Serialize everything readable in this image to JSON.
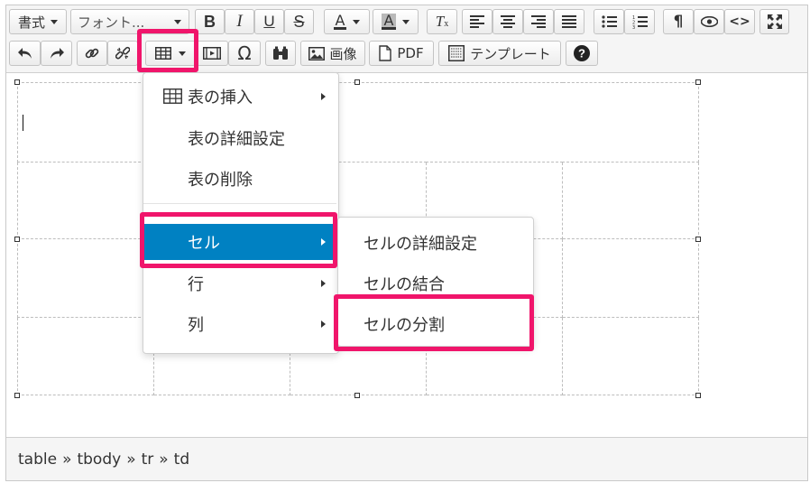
{
  "toolbar": {
    "format_label": "書式",
    "font_label": "フォント...",
    "image_label": "画像",
    "pdf_label": "PDF",
    "template_label": "テンプレート"
  },
  "table_menu": {
    "items": [
      {
        "label": "表の挿入",
        "icon": "table-icon",
        "submenu": true
      },
      {
        "label": "表の詳細設定",
        "submenu": false
      },
      {
        "label": "表の削除",
        "submenu": false
      },
      {
        "label": "セル",
        "submenu": true,
        "active": true
      },
      {
        "label": "行",
        "submenu": true
      },
      {
        "label": "列",
        "submenu": true
      }
    ]
  },
  "cell_submenu": {
    "items": [
      {
        "label": "セルの詳細設定"
      },
      {
        "label": "セルの結合"
      },
      {
        "label": "セルの分割"
      }
    ]
  },
  "statusbar": {
    "path": [
      "table",
      "tbody",
      "tr",
      "td"
    ],
    "separator": "»"
  },
  "colors": {
    "accent": "#0081c2",
    "highlight": "#f0156b"
  }
}
